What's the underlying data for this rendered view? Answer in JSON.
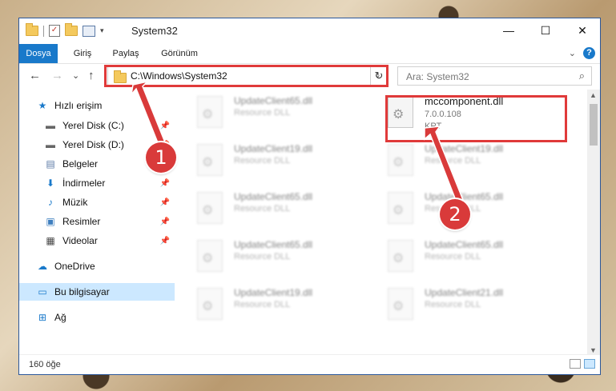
{
  "window": {
    "title": "System32",
    "minimize": "—",
    "maximize": "☐",
    "close": "✕"
  },
  "ribbon": {
    "tabs": [
      {
        "label": "Dosya",
        "active": true
      },
      {
        "label": "Giriş"
      },
      {
        "label": "Paylaş"
      },
      {
        "label": "Görünüm"
      }
    ],
    "help": "?"
  },
  "nav": {
    "back": "←",
    "forward": "→",
    "recent": "⌄",
    "up": "↑",
    "address": "C:\\Windows\\System32",
    "search_placeholder": "Ara: System32"
  },
  "sidebar": {
    "quick_access": "Hızlı erişim",
    "items": [
      {
        "label": "Yerel Disk (C:)",
        "pinned": true
      },
      {
        "label": "Yerel Disk (D:)",
        "pinned": true
      },
      {
        "label": "Belgeler",
        "pinned": true
      },
      {
        "label": "İndirmeler",
        "pinned": true
      },
      {
        "label": "Müzik",
        "pinned": true
      },
      {
        "label": "Resimler",
        "pinned": true
      },
      {
        "label": "Videolar",
        "pinned": true
      }
    ],
    "onedrive": "OneDrive",
    "this_pc": "Bu bilgisayar",
    "network": "Ağ"
  },
  "files": {
    "left": [
      {
        "name": "UpdateClient65.dll",
        "desc": "Resource DLL"
      },
      {
        "name": "UpdateClient19.dll",
        "desc": "Resource DLL"
      },
      {
        "name": "UpdateClient65.dll",
        "desc": "Resource DLL"
      },
      {
        "name": "UpdateClient65.dll",
        "desc": "Resource DLL"
      },
      {
        "name": "UpdateClient19.dll",
        "desc": "Resource DLL"
      }
    ],
    "right_featured": {
      "name": "mccomponent.dll",
      "version": "7.0.0.108",
      "company": "KPT"
    },
    "right": [
      {
        "name": "UpdateClient19.dll",
        "desc": "Resource DLL"
      },
      {
        "name": "UpdateClient65.dll",
        "desc": "Resource DLL"
      },
      {
        "name": "UpdateClient65.dll",
        "desc": "Resource DLL"
      },
      {
        "name": "UpdateClient21.dll",
        "desc": "Resource DLL"
      }
    ]
  },
  "status": {
    "count": "160 öğe"
  },
  "annotations": {
    "one": "1",
    "two": "2"
  },
  "colors": {
    "accent": "#1979ca",
    "highlight": "#e03a3a",
    "selection": "#cce8ff"
  }
}
